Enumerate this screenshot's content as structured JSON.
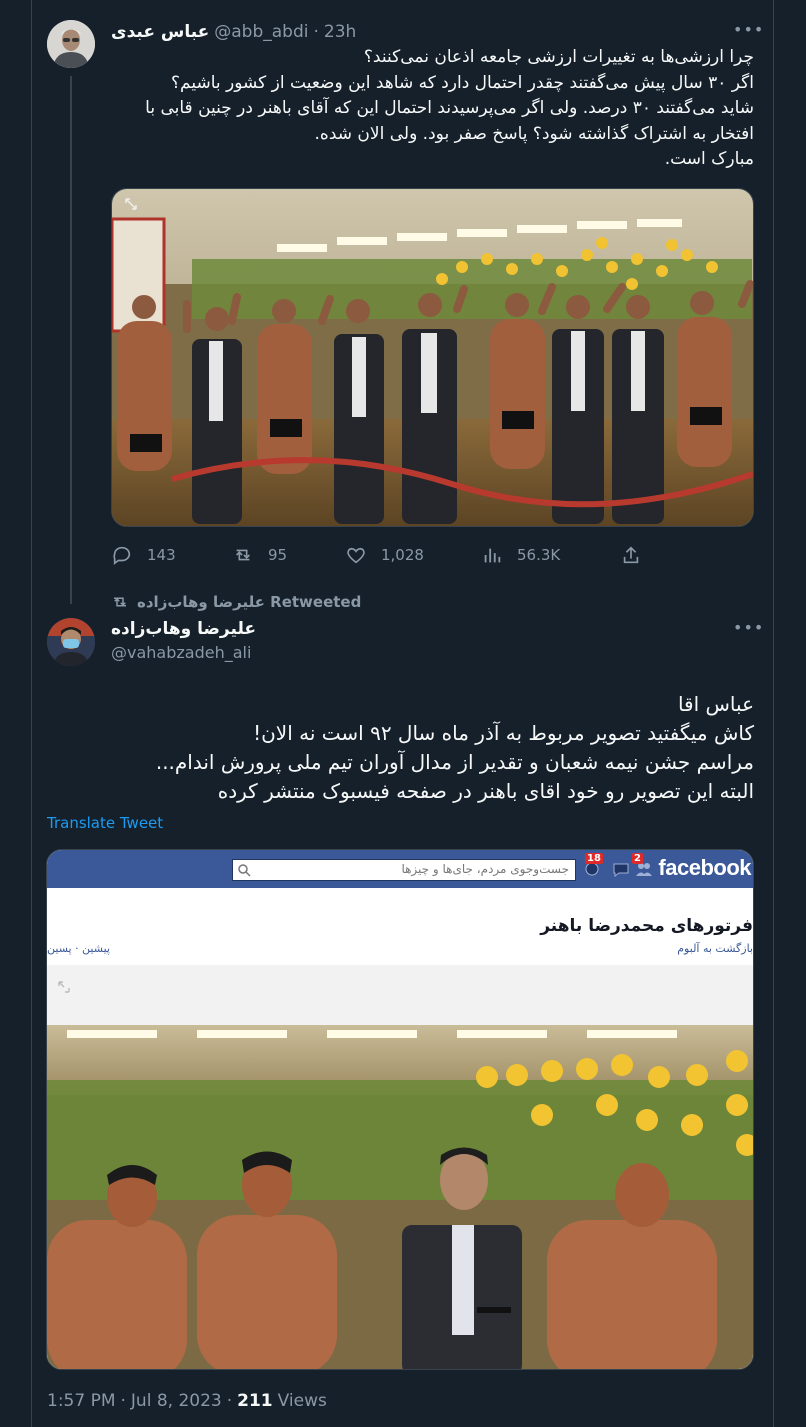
{
  "tweet1": {
    "display_name": "عباس عبدی",
    "handle": "@abb_abdi",
    "separator": "·",
    "time": "23h",
    "lines": [
      "چرا ارزشی‌ها به تغییرات ارزشی جامعه اذعان نمی‌کنند؟",
      "اگر ۳۰ سال پیش می‌گفتند چقدر احتمال دارد که شاهد این وضعیت از کشور باشیم؟",
      "شاید می‌گفتند ۳۰ درصد. ولی اگر می‌پرسیدند احتمال این که آقای باهنر در چنین قابی با",
      "افتخار به اشتراک گذاشته شود؟ پاسخ صفر بود. ولی الان شده.",
      "مبارک است."
    ],
    "actions": {
      "replies": "143",
      "retweets": "95",
      "likes": "1,028",
      "views": "56.3K"
    }
  },
  "retweet_context": {
    "label": "علیرضا وهاب‌زاده Retweeted"
  },
  "tweet2": {
    "display_name": "علیرضا وهاب‌زاده",
    "handle": "@vahabzadeh_ali",
    "lines": [
      "عباس اقا",
      "کاش میگفتید تصویر مربوط به آذر ماه سال ۹۲ است نه الان!",
      "مراسم جشن نیمه شعبان و تقدیر از مدال آوران تیم ملی پرورش اندام...",
      "البته این تصویر رو خود اقای باهنر در صفحه فیسبوک منتشر کرده"
    ],
    "translate": "Translate Tweet",
    "facebook": {
      "logo": "facebook",
      "search_placeholder": "جست‌وجوی مردم، جای‌ها و چیزها",
      "friend_badge": "18",
      "message_badge": "2",
      "album_title": "فرتورهای محمدرضا باهنر",
      "back_link": "بازگشت به آلبوم",
      "nav": "پیشین · پسین"
    },
    "meta": {
      "time": "1:57 PM",
      "dot1": "·",
      "date": "Jul 8, 2023",
      "dot2": "·",
      "views_count": "211",
      "views_label": "Views"
    }
  },
  "colors": {
    "background": "#15202b",
    "text": "#f7f9f9",
    "muted": "#8b98a5",
    "link": "#1d9bf0",
    "border": "#38444d",
    "facebook_blue": "#3b5998"
  }
}
